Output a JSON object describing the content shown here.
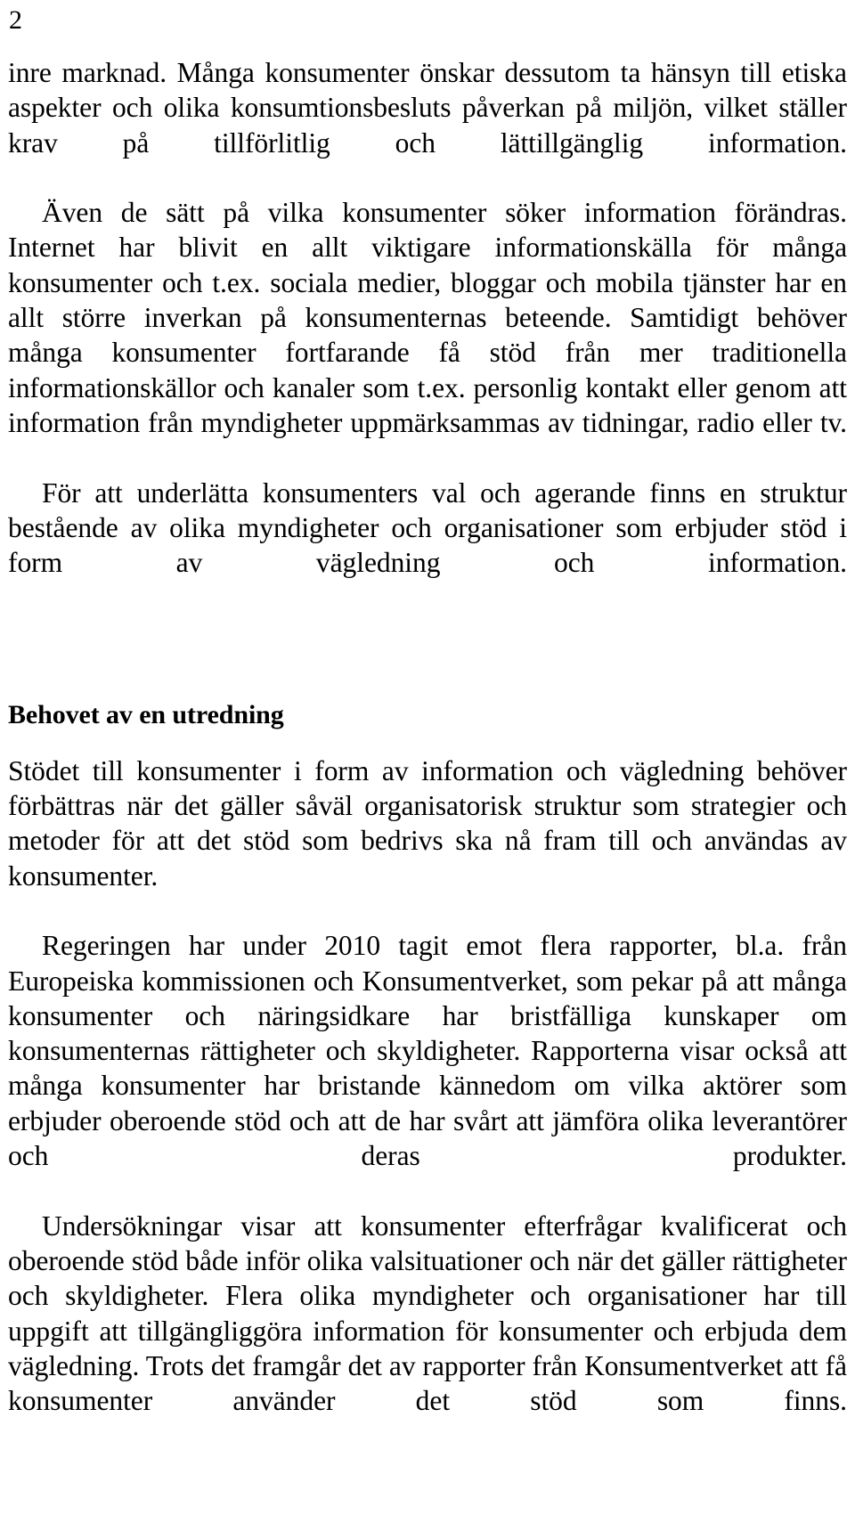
{
  "document": {
    "language": "sv",
    "page_number": "2",
    "body_blocks": [
      {
        "id": "par-1",
        "type": "paragraph",
        "indent": false,
        "text": "inre marknad. Många konsumenter önskar dessutom ta hänsyn till etiska aspekter och olika konsumtionsbesluts påverkan på miljön, vilket ställer krav på tillförlitlig och lättillgänglig information."
      },
      {
        "id": "par-2",
        "type": "paragraph",
        "indent": true,
        "text": "Även de sätt på vilka konsumenter söker information förändras. Internet har blivit en allt viktigare informationskälla för många konsumenter och t.ex. sociala medier, bloggar och mobila tjänster har en allt större inverkan på konsumenternas beteende. Samtidigt behöver många konsumenter fortfarande få stöd från mer traditionella informationskällor och kanaler som t.ex. personlig kontakt eller genom att information från myndigheter uppmärksammas av tidningar, radio eller tv."
      },
      {
        "id": "par-3",
        "type": "paragraph",
        "indent": true,
        "text": "För att underlätta konsumenters val och agerande finns en struktur bestående av olika myndigheter och organisationer som erbjuder stöd i form av vägledning och information."
      },
      {
        "id": "heading-1",
        "type": "heading",
        "text": "Behovet av en utredning"
      },
      {
        "id": "par-4",
        "type": "paragraph",
        "indent": false,
        "text": "Stödet till konsumenter i form av information och vägledning behöver förbättras när det gäller såväl organisatorisk struktur som strategier och metoder för att det stöd som bedrivs ska nå fram till och användas av konsumenter."
      },
      {
        "id": "par-5",
        "type": "paragraph",
        "indent": true,
        "text": "Regeringen har under 2010 tagit emot flera rapporter, bl.a. från Europeiska kommissionen och Konsumentverket, som pekar på att många konsumenter och näringsidkare har bristfälliga kunskaper om konsumenternas rättigheter och skyldigheter. Rapporterna visar också att många konsumenter har bristande kännedom om vilka aktörer som erbjuder oberoende stöd och att de har svårt att jämföra olika leverantörer och deras produkter."
      },
      {
        "id": "par-6",
        "type": "paragraph",
        "indent": true,
        "text": "Undersökningar visar att konsumenter efterfrågar kvalificerat och oberoende stöd både inför olika valsituationer och när det gäller rättigheter och skyldigheter. Flera olika myndigheter och organisationer har till uppgift att tillgängliggöra information för konsumenter och erbjuda dem vägledning. Trots det framgår det av rapporter från Konsumentverket att få konsumenter använder det stöd som finns."
      }
    ]
  }
}
